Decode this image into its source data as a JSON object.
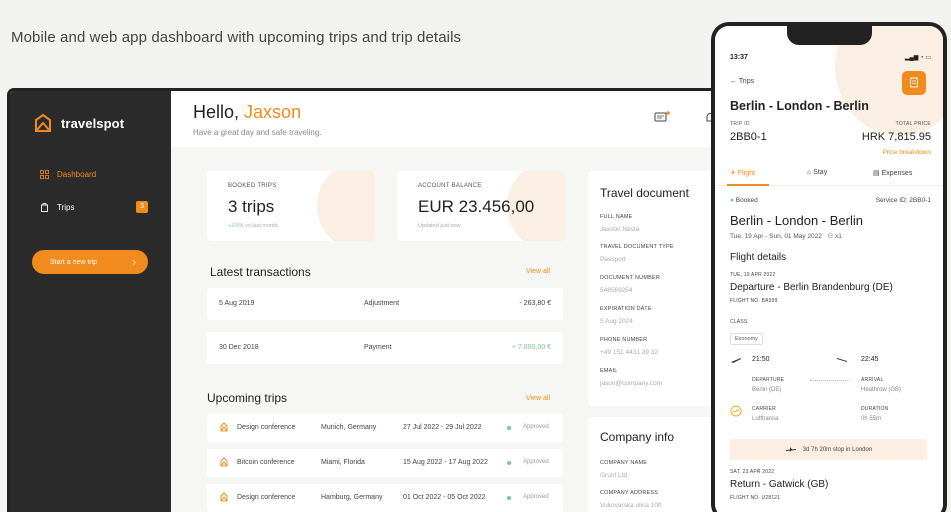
{
  "caption": "Mobile and web app dashboard with upcoming trips and trip details",
  "colors": {
    "accent": "#f28b1e",
    "sidebar": "#2b2b2b",
    "success": "#7dc78a"
  },
  "sidebar": {
    "brand": "travelspot",
    "items": [
      {
        "label": "Dashboard",
        "icon": "grid-icon",
        "active": true
      },
      {
        "label": "Trips",
        "icon": "suitcase-icon",
        "badge": "3"
      }
    ],
    "cta": "Start a new trip",
    "cta_arrow": "›"
  },
  "header": {
    "greeting": "Hello,",
    "name": "Jaxson",
    "subtitle": "Have a great day and safe traveling."
  },
  "stats": {
    "booked": {
      "label": "BOOKED TRIPS",
      "value": "3 trips",
      "change": "+2.5%",
      "note": "vs last month"
    },
    "balance": {
      "label": "ACCOUNT BALANCE",
      "value": "EUR 23.456,00",
      "note": "Updated just now"
    }
  },
  "transactions": {
    "title": "Latest transactions",
    "view_all": "View all",
    "rows": [
      {
        "date": "5 Aug 2019",
        "type": "Adjustment",
        "amount": "- 263,80 €",
        "positive": false
      },
      {
        "date": "30 Dec 2018",
        "type": "Payment",
        "amount": "+ 7.000,00 €",
        "positive": true
      }
    ]
  },
  "upcoming": {
    "title": "Upcoming trips",
    "view_all": "View all",
    "rows": [
      {
        "name": "Design conference",
        "place": "Munich, Germany",
        "dates": "27 Jul 2022 - 29 Jul 2022",
        "status": "Approved"
      },
      {
        "name": "Bitcoin conference",
        "place": "Miami, Florida",
        "dates": "15 Aug 2022 - 17 Aug 2022",
        "status": "Approved"
      },
      {
        "name": "Design conference",
        "place": "Hamburg, Germany",
        "dates": "01 Oct 2022 - 05 Oct 2022",
        "status": "Approved"
      }
    ]
  },
  "document": {
    "title": "Travel document",
    "fields": [
      {
        "label": "FULL NAME",
        "value": "Jaxson Nesta"
      },
      {
        "label": "TRAVEL DOCUMENT TYPE",
        "value": "Passport"
      },
      {
        "label": "DOCUMENT NUMBER",
        "value": "548569254"
      },
      {
        "label": "EXPIRATION DATE",
        "value": "5 Aug 2024"
      },
      {
        "label": "PHONE NUMBER",
        "value": "+49 151 4431 39 32"
      },
      {
        "label": "EMAIL",
        "value": "jason@company.com"
      }
    ]
  },
  "company": {
    "title": "Company info",
    "fields": [
      {
        "label": "COMPANY NAME",
        "value": "Grunf Ltd"
      },
      {
        "label": "COMPANY ADDRESS",
        "value": "Vukovarska ulica 100"
      }
    ]
  },
  "phone": {
    "time": "13:37",
    "status_icons": "▂▄▆ ◔ ▭",
    "back": "← Trips",
    "route": "Berlin - London - Berlin",
    "trip_id_label": "TRIP ID",
    "trip_id": "2BB0-1",
    "total_label": "TOTAL PRICE",
    "total": "HRK 7,815.95",
    "breakdown": "Price breakdown",
    "tabs": [
      "Flight",
      "Stay",
      "Expenses"
    ],
    "status": "Booked",
    "service_id": "Service ID: 2BB0-1",
    "route2": "Berlin - London - Berlin",
    "dates": "Tue, 19 Apr - Sun, 01 May 2022",
    "pax": "x1",
    "flight_details": "Flight details",
    "leg1": {
      "date": "TUE, 19 APR 2022",
      "title": "Departure - Berlin Brandenburg (DE)",
      "flight_no": "FLIGHT NO. BA999",
      "class_label": "CLASS",
      "class": "Economy",
      "dep_time": "21:50",
      "arr_time": "22:45",
      "dep_label": "DEPARTURE",
      "dep_airport": "Berlin (DE)",
      "arr_label": "ARRIVAL",
      "arr_airport": "Heathrow (GB)",
      "carrier_label": "CARRIER",
      "carrier": "Lufthansa",
      "duration_label": "DURATION",
      "duration": "0h 55m"
    },
    "stop": "3d 7h 20m stop in London",
    "leg2": {
      "date": "SAT, 23 APR 2022",
      "title": "Return - Gatwick (GB)",
      "flight_no": "FLIGHT NO. U28121"
    }
  }
}
